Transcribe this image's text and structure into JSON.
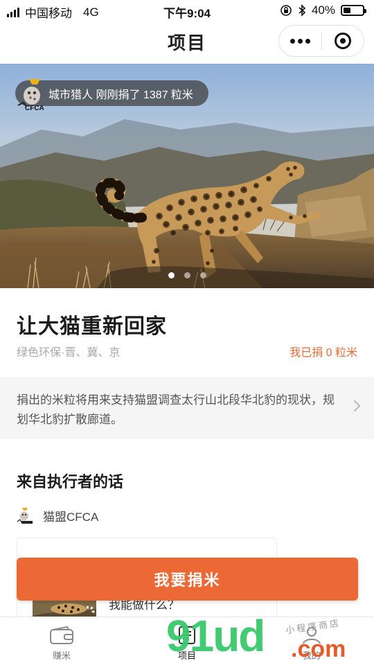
{
  "status_bar": {
    "carrier": "中国移动",
    "network": "4G",
    "time": "下午9:04",
    "battery_text": "40%",
    "battery_level": 0.4
  },
  "nav": {
    "title": "项目"
  },
  "banner": {
    "toast_text": "城市猎人 刚刚捐了 1387 粒米",
    "logo_text": "CFCA",
    "pages": 3,
    "active_page": 0
  },
  "project": {
    "title": "让大猫重新回家",
    "tag": "绿色环保·晋、冀、京",
    "donated": "我已捐 0 粒米",
    "description": "捐出的米粒将用来支持猫盟调查太行山北段华北豹的现状，规划华北豹扩散廊道。"
  },
  "executor": {
    "section_title": "来自执行者的话",
    "org_name": "猫盟CFCA",
    "card_text": "我能做什么？"
  },
  "donate_button": "我要捐米",
  "tabs": [
    {
      "label": "赚米",
      "icon": "wallet-icon"
    },
    {
      "label": "项目",
      "icon": "project-icon",
      "active": true
    },
    {
      "label": "我的",
      "icon": "profile-icon"
    }
  ],
  "watermark": {
    "brand": "91ud",
    "suffix": ".com",
    "chinese": "小程序商店"
  },
  "colors": {
    "accent": "#ec6936",
    "donated_text": "#e86a3a",
    "watermark_green": "#38c96c",
    "watermark_orange": "#e55b2a"
  }
}
